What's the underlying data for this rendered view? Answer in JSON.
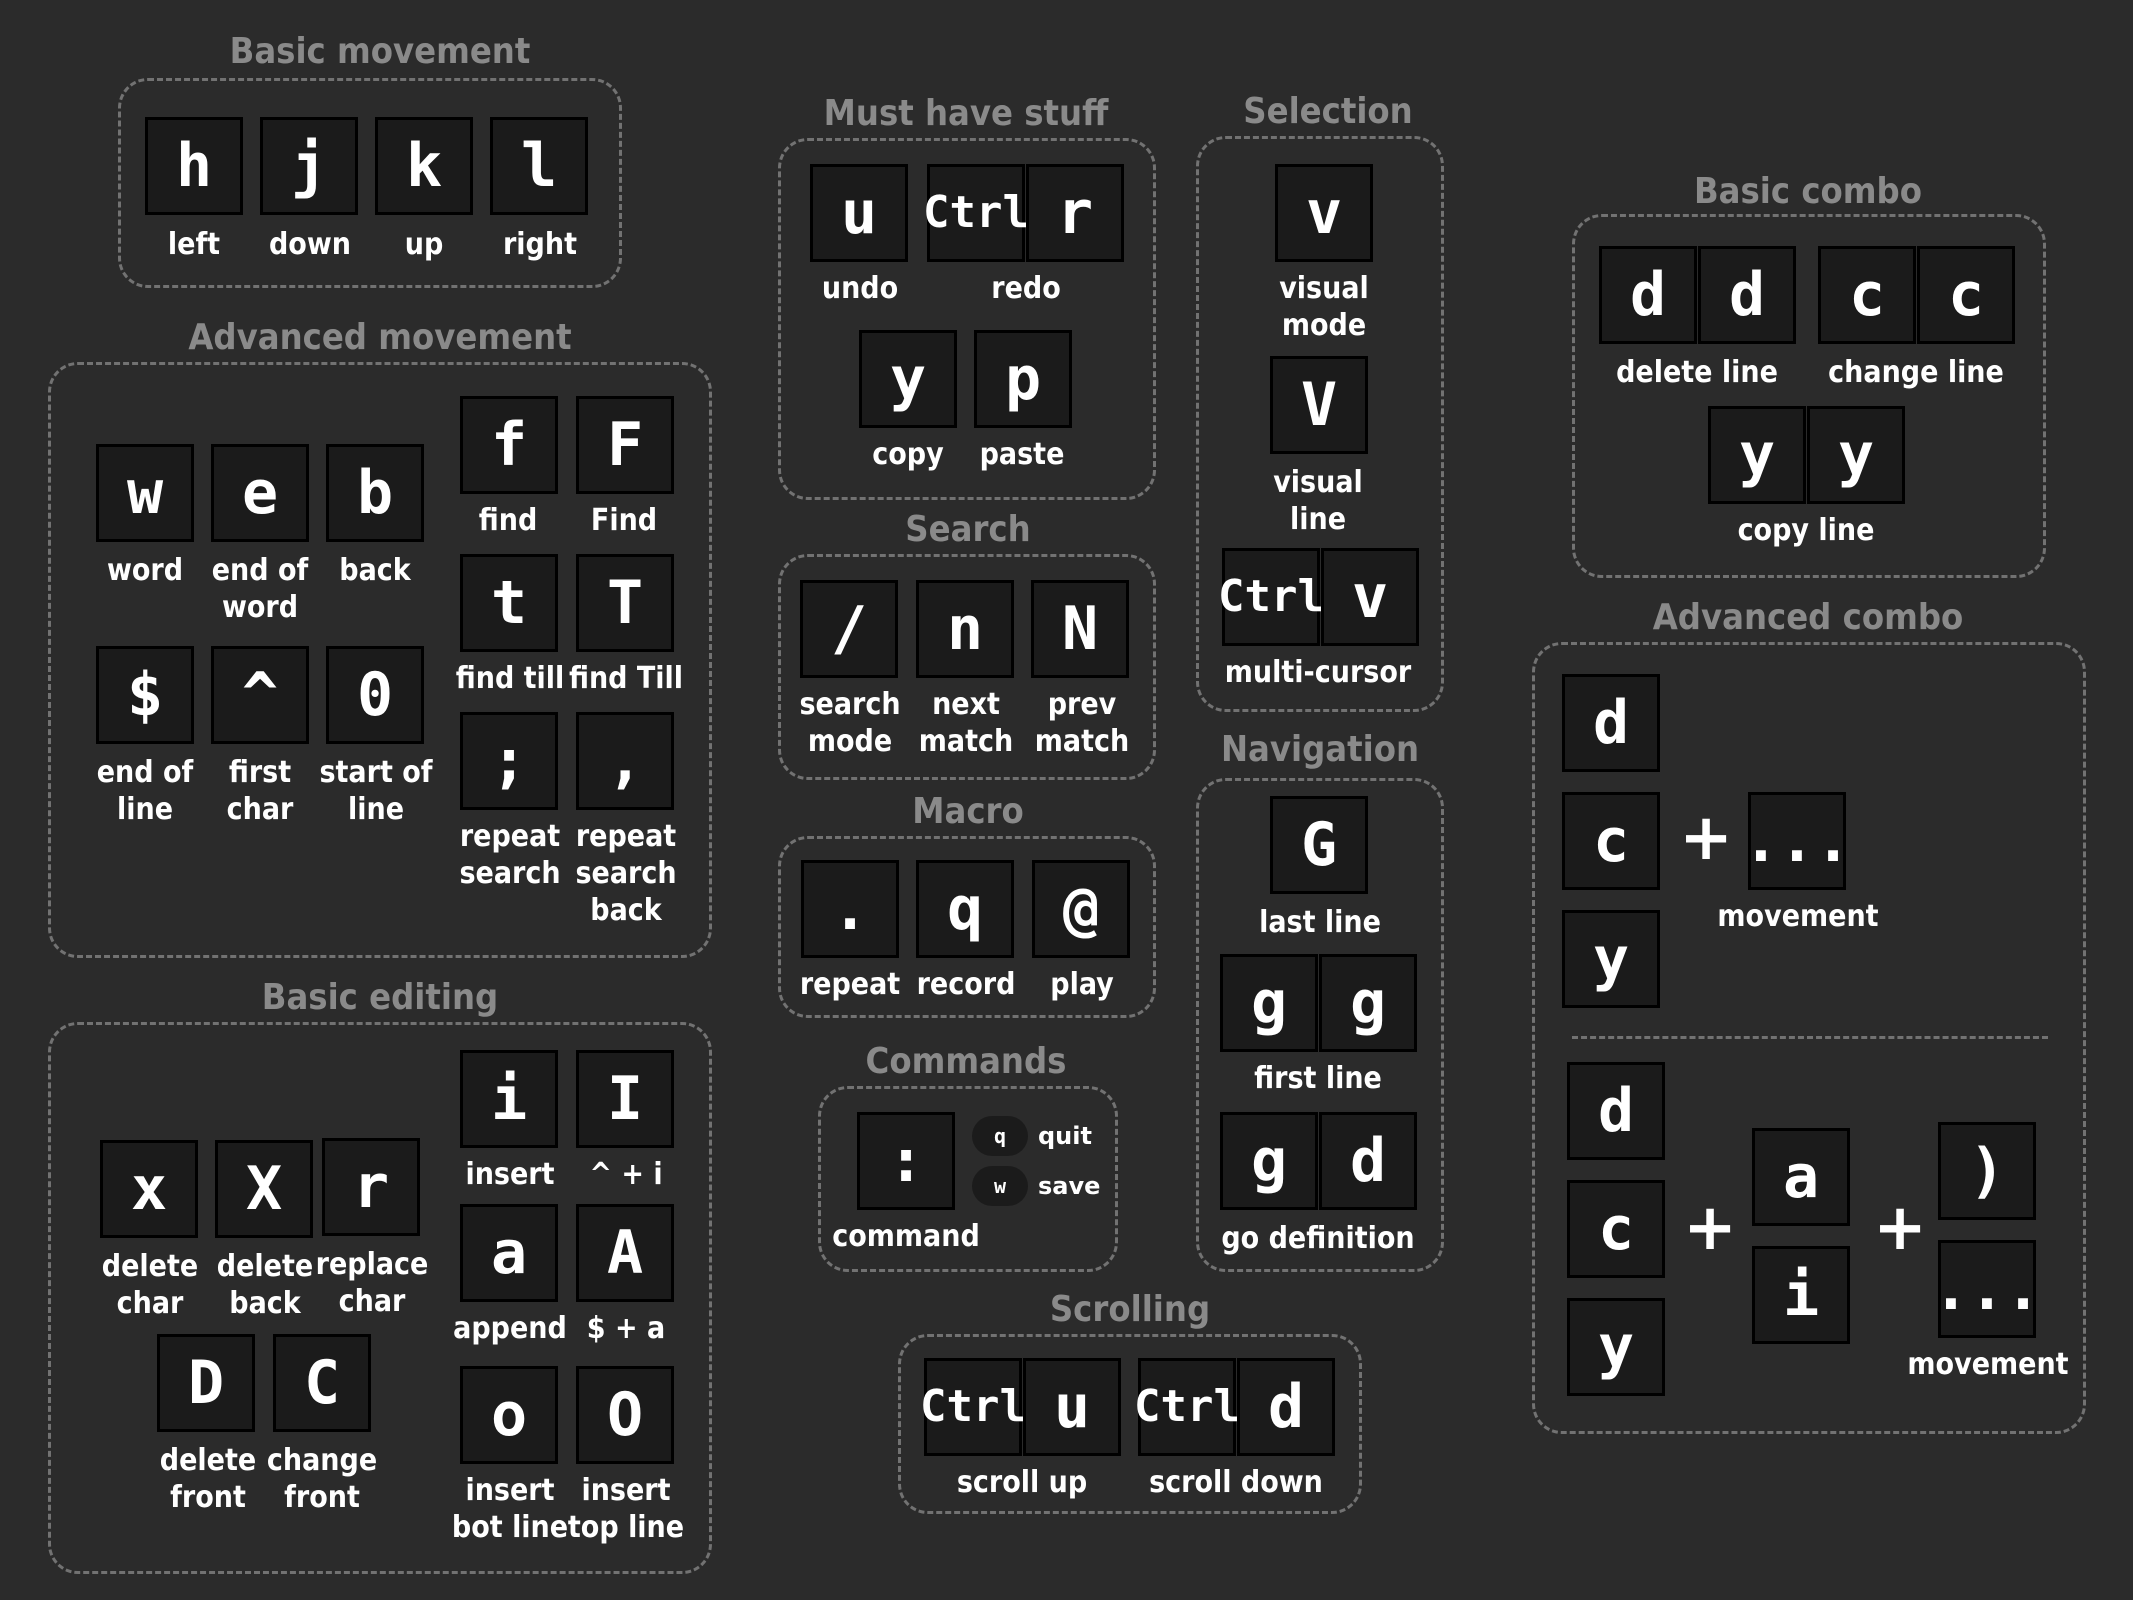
{
  "sections": {
    "basic_movement": "Basic movement",
    "advanced_movement": "Advanced movement",
    "basic_editing": "Basic editing",
    "must_have": "Must have stuff",
    "search": "Search",
    "macro": "Macro",
    "commands": "Commands",
    "scrolling": "Scrolling",
    "selection": "Selection",
    "navigation": "Navigation",
    "basic_combo": "Basic combo",
    "advanced_combo": "Advanced combo"
  },
  "keys": {
    "h": "h",
    "j": "j",
    "k": "k",
    "l": "l",
    "w": "w",
    "e": "e",
    "b": "b",
    "dollar": "$",
    "caret": "^",
    "zero": "0",
    "f": "f",
    "F": "F",
    "t": "t",
    "T": "T",
    "semicolon": ";",
    "comma": ",",
    "x": "x",
    "X": "X",
    "r": "r",
    "D": "D",
    "C": "C",
    "i": "i",
    "I": "I",
    "a": "a",
    "A": "A",
    "o": "o",
    "O": "O",
    "u": "u",
    "ctrl": "Ctrl",
    "y": "y",
    "p": "p",
    "slash": "/",
    "n": "n",
    "N": "N",
    "dot": ".",
    "q": "q",
    "at": "@",
    "colon": ":",
    "v": "v",
    "V": "V",
    "G": "G",
    "g": "g",
    "d": "d",
    "c": "c",
    "ellipsis": "...",
    "paren": ")"
  },
  "labels": {
    "left": "left",
    "down": "down",
    "up": "up",
    "right": "right",
    "word": "word",
    "end_of_word": "end of\nword",
    "back": "back",
    "end_of_line": "end of\nline",
    "first_char": "first\nchar",
    "start_of_line": "start of\nline",
    "find": "find",
    "find_cap": "Find",
    "find_till": "find till",
    "find_till_cap": "find Till",
    "repeat_search": "repeat\nsearch",
    "repeat_search_back": "repeat\nsearch\nback",
    "delete_char": "delete\nchar",
    "delete_back": "delete\nback",
    "replace_char": "replace\nchar",
    "delete_front": "delete\nfront",
    "change_front": "change\nfront",
    "insert": "insert",
    "caret_i": "^ + i",
    "append": "append",
    "dollar_a": "$ + a",
    "insert_bot_line": "insert\nbot line",
    "insert_top_line": "insert\ntop line",
    "undo": "undo",
    "redo": "redo",
    "copy": "copy",
    "paste": "paste",
    "search_mode": "search\nmode",
    "next_match": "next\nmatch",
    "prev_match": "prev\nmatch",
    "repeat": "repeat",
    "record": "record",
    "play": "play",
    "command": "command",
    "quit": "quit",
    "save": "save",
    "scroll_up": "scroll up",
    "scroll_down": "scroll down",
    "visual_mode": "visual\nmode",
    "visual_line": "visual\nline",
    "multi_cursor": "multi-cursor",
    "last_line": "last line",
    "first_line": "first line",
    "go_definition": "go definition",
    "delete_line": "delete line",
    "change_line": "change line",
    "copy_line": "copy line",
    "movement": "movement",
    "plus": "+"
  },
  "pills": {
    "q": "q",
    "w": "w"
  }
}
